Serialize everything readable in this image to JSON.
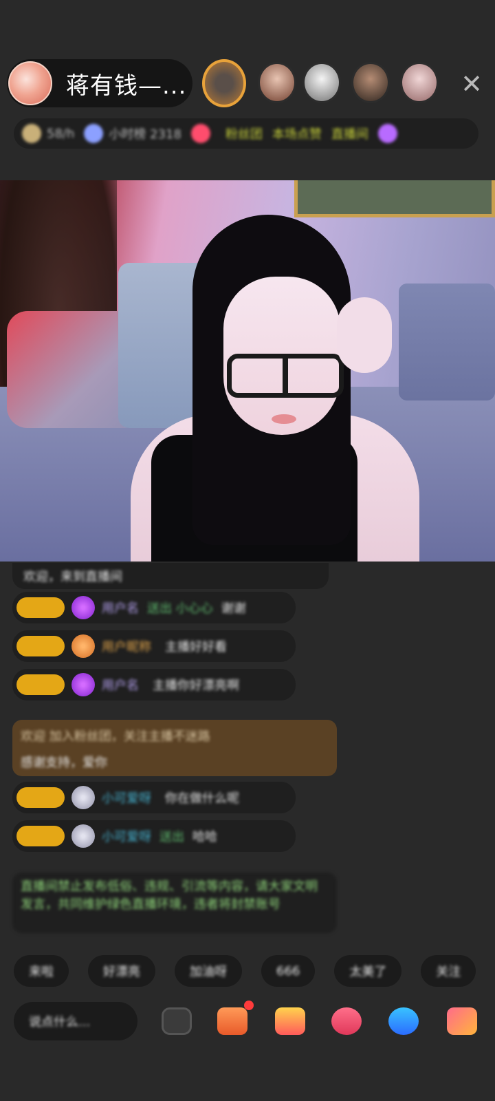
{
  "header": {
    "host_name": "蒋有钱—...",
    "close_icon": "✕",
    "info_bar": {
      "items": [
        "58/h",
        "小时榜 2318",
        "粉丝团",
        "本场点赞",
        "直播间"
      ]
    }
  },
  "chat": {
    "messages": [
      {
        "text": "欢迎，来到直播间"
      },
      {
        "user": "用户名",
        "action": "送出 小心心",
        "content": "谢谢"
      },
      {
        "user": "用户昵称",
        "content": "主播好好看"
      },
      {
        "user": "用户名",
        "content": "主播你好漂亮啊"
      },
      {
        "highlight": "欢迎 加入粉丝团，关注主播不迷路",
        "highlight_line2": "感谢支持，爱你"
      },
      {
        "user": "小可爱呀",
        "content": "你在做什么呢"
      },
      {
        "user": "小可爱呀",
        "action": "送出",
        "content": "哈哈"
      },
      {
        "system": "直播间禁止发布低俗、违规、引流等内容，请大家文明发言，共同维护绿色直播环境，违者将封禁账号"
      }
    ]
  },
  "quick_replies": [
    "来啦",
    "好漂亮",
    "加油呀",
    "666",
    "太美了",
    "关注"
  ],
  "bottom_bar": {
    "comment_placeholder": "说点什么...",
    "icons": [
      "emoji-icon",
      "shop-icon",
      "gift-icon",
      "chat-icon",
      "message-icon",
      "more-gift-icon"
    ]
  },
  "colors": {
    "background": "#292929",
    "level_badge": "#e4a716",
    "highlight_bg": "#5a4124",
    "system_text": "#8fd67a"
  }
}
